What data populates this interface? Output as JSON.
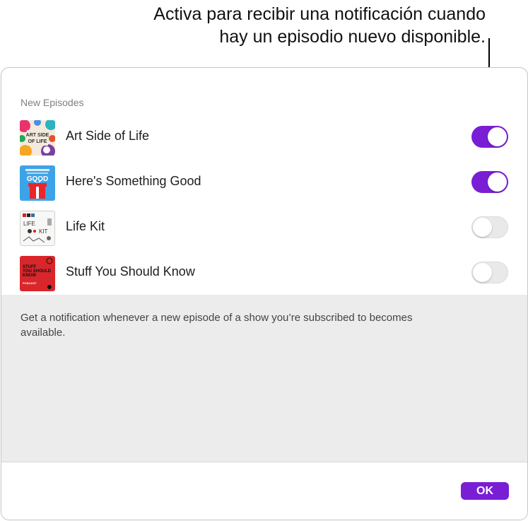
{
  "callout": {
    "line1": "Activa para recibir una notificación cuando",
    "line2": "hay un episodio nuevo disponible."
  },
  "dialog": {
    "section_title": "New Episodes",
    "shows": [
      {
        "name": "Art Side of Life",
        "enabled": true,
        "artwork_text": [
          "ART SIDE",
          "OF LIFE"
        ],
        "artwork_icon": "art-side-of-life-artwork"
      },
      {
        "name": "Here's Something Good",
        "enabled": true,
        "artwork_text": [
          "GOOD"
        ],
        "artwork_icon": "heres-something-good-artwork"
      },
      {
        "name": "Life Kit",
        "enabled": false,
        "artwork_text": [
          "npr",
          "LIFE",
          "KIT"
        ],
        "artwork_icon": "life-kit-artwork"
      },
      {
        "name": "Stuff You Should Know",
        "enabled": false,
        "artwork_text": [
          "STUFF",
          "YOU SHOULD",
          "KNOW",
          "PODCAST"
        ],
        "artwork_icon": "stuff-you-should-know-artwork"
      }
    ],
    "info_text": "Get a notification whenever a new episode of a show you’re subscribed to becomes available.",
    "ok_label": "OK"
  },
  "colors": {
    "accent": "#7a1ed6",
    "toggle_off": "#e9e9e9",
    "info_background": "#ececec"
  }
}
